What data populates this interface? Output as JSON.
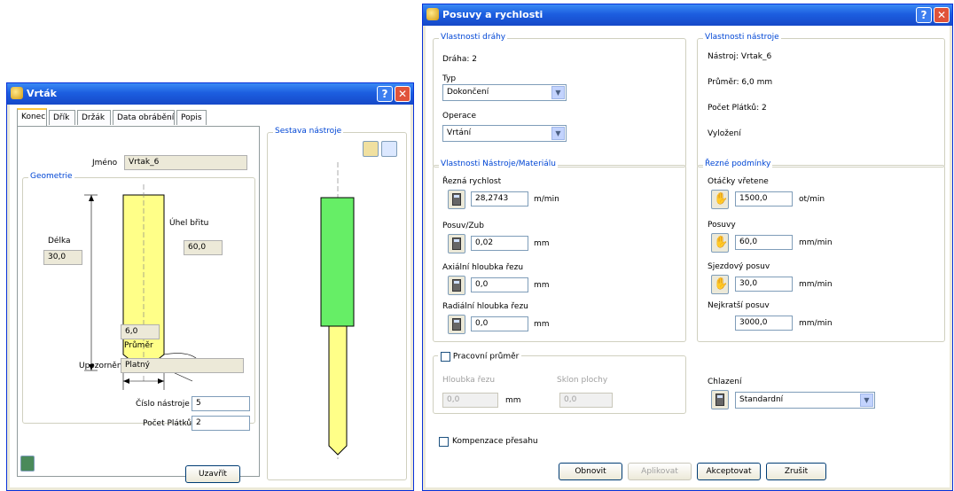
{
  "left_dialog": {
    "title": "Vrták",
    "tabs": [
      "Konec",
      "Dřík",
      "Držák",
      "Data obrábění",
      "Popis"
    ],
    "name_label": "Jméno",
    "name_value": "Vrtak_6",
    "geometry_group": "Geometrie",
    "length_label": "Délka",
    "length_value": "30,0",
    "tip_angle_label": "Úhel břitu",
    "tip_angle_value": "60,0",
    "diameter_value": "6,0",
    "diameter_label": "Průměr",
    "warning_label": "Upozornění",
    "warning_value": "Platný",
    "tool_number_label": "Číslo nástroje",
    "tool_number_value": "5",
    "flutes_label": "Počet Plátků",
    "flutes_value": "2",
    "assembly_group": "Sestava nástroje",
    "close_button": "Uzavřít"
  },
  "right_dialog": {
    "title": "Posuvy a rychlosti",
    "path_group": "Vlastnosti dráhy",
    "path_text": "Dráha: 2",
    "type_label": "Typ",
    "type_value": "Dokončení",
    "operation_label": "Operace",
    "operation_value": "Vrtání",
    "tool_group": "Vlastnosti nástroje",
    "tool_name": "Nástroj: Vrtak_6",
    "tool_diameter": "Průměr: 6,0 mm",
    "tool_flutes": "Počet Plátků: 2",
    "tool_overhang": "Vyložení",
    "material_group": "Vlastnosti Nástroje/Materiálu",
    "cutting_speed_label": "Řezná rychlost",
    "cutting_speed_value": "28,2743",
    "cutting_speed_unit": "m/min",
    "feed_tooth_label": "Posuv/Zub",
    "feed_tooth_value": "0,02",
    "feed_tooth_unit": "mm",
    "axial_depth_label": "Axiální hloubka řezu",
    "axial_depth_value": "0,0",
    "axial_depth_unit": "mm",
    "radial_depth_label": "Radiální hloubka řezu",
    "radial_depth_value": "0,0",
    "radial_depth_unit": "mm",
    "cutting_group": "Řezné podmínky",
    "spindle_label": "Otáčky vřetene",
    "spindle_value": "1500,0",
    "spindle_unit": "ot/min",
    "feeds_label": "Posuvy",
    "feeds_value": "60,0",
    "feeds_unit": "mm/min",
    "plunge_label": "Sjezdový posuv",
    "plunge_value": "30,0",
    "plunge_unit": "mm/min",
    "rapid_label": "Nejkratší posuv",
    "rapid_value": "3000,0",
    "rapid_unit": "mm/min",
    "working_diameter_label": "Pracovní průměr",
    "cut_depth_label": "Hloubka řezu",
    "cut_depth_value": "0,0",
    "cut_depth_unit": "mm",
    "surface_slope_label": "Sklon plochy",
    "surface_slope_value": "0,0",
    "coolant_label": "Chlazení",
    "coolant_value": "Standardní",
    "overlap_label": "Kompenzace přesahu",
    "refresh_button": "Obnovit",
    "apply_button": "Aplikovat",
    "accept_button": "Akceptovat",
    "cancel_button": "Zrušit"
  },
  "colors": {
    "title_bar": "#1c5ee0",
    "group_title": "#0046d5",
    "tool_shank": "#66ee66",
    "tool_body": "#ffff88"
  }
}
